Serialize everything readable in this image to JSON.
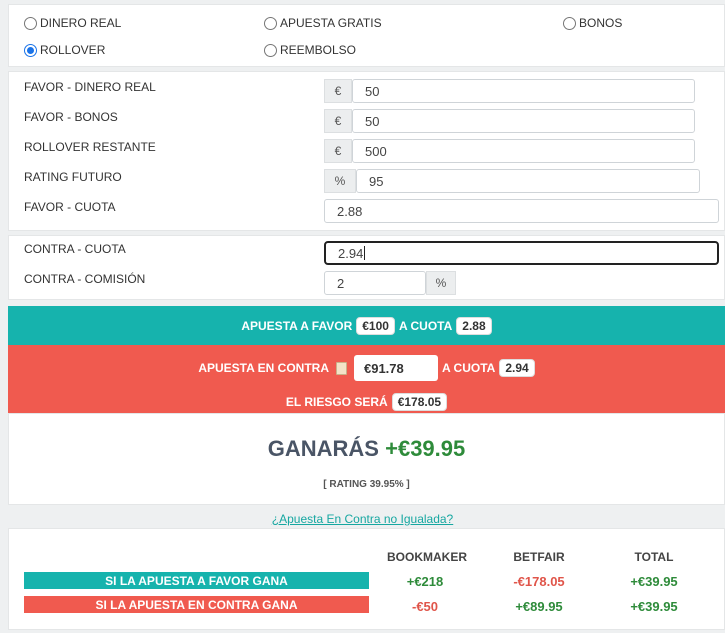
{
  "bet_types": [
    {
      "label": "DINERO REAL",
      "selected": false
    },
    {
      "label": "APUESTA GRATIS",
      "selected": false
    },
    {
      "label": "BONOS",
      "selected": false
    },
    {
      "label": "ROLLOVER",
      "selected": true
    },
    {
      "label": "REEMBOLSO",
      "selected": false
    }
  ],
  "favor": {
    "dinero_real": {
      "label": "FAVOR - DINERO REAL",
      "addon": "€",
      "value": "50"
    },
    "bonos": {
      "label": "FAVOR - BONOS",
      "addon": "€",
      "value": "50"
    },
    "rollover": {
      "label": "ROLLOVER RESTANTE",
      "addon": "€",
      "value": "500"
    },
    "rating": {
      "label": "RATING FUTURO",
      "addon": "%",
      "value": "95"
    },
    "cuota": {
      "label": "FAVOR - CUOTA",
      "value": "2.88"
    }
  },
  "contra": {
    "cuota": {
      "label": "CONTRA - CUOTA",
      "value": "2.94"
    },
    "comision": {
      "label": "CONTRA - COMISIÓN",
      "value": "2",
      "addon": "%"
    }
  },
  "result_favor": {
    "prefix": "APUESTA A FAVOR",
    "stake": "€100",
    "mid": "A CUOTA",
    "odds": "2.88"
  },
  "result_contra": {
    "prefix": "APUESTA EN CONTRA",
    "stake": "€91.78",
    "mid": "A CUOTA",
    "odds": "2.94",
    "risk_label": "EL RIESGO SERÁ",
    "risk": "€178.05"
  },
  "profit": {
    "label": "GANARÁS",
    "value": "+€39.95",
    "rating": "[ RATING 39.95% ]"
  },
  "unmatched_link": "¿Apuesta En Contra no Igualada?",
  "table": {
    "headers": [
      "BOOKMAKER",
      "BETFAIR",
      "TOTAL"
    ],
    "rows": [
      {
        "label": "SI LA APUESTA A FAVOR GANA",
        "color": "#16b3ad",
        "values": [
          "+€218",
          "-€178.05",
          "+€39.95"
        ]
      },
      {
        "label": "SI LA APUESTA EN CONTRA GANA",
        "color": "#f05a4f",
        "values": [
          "-€50",
          "+€89.95",
          "+€39.95"
        ]
      }
    ]
  },
  "colors": {
    "teal": "#16b3ad",
    "red": "#f05a4f",
    "green": "#2e8b3a"
  }
}
